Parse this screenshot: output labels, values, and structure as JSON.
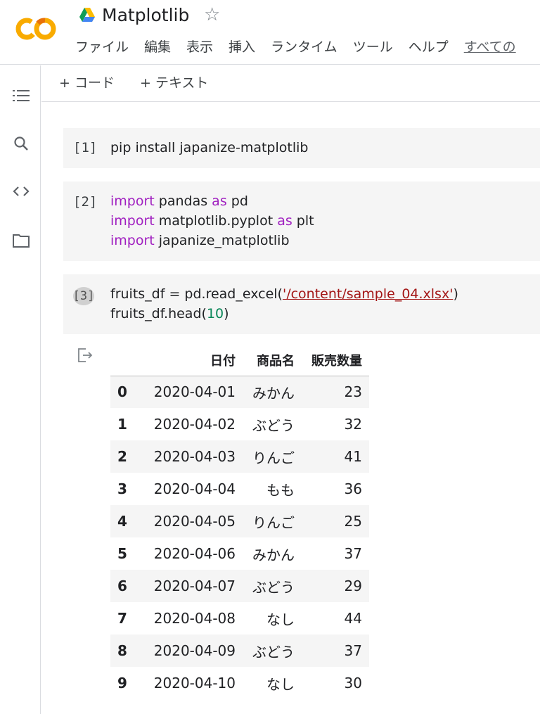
{
  "app": {
    "logo_text": "CO",
    "title": "Matplotlib",
    "star_icon": "☆"
  },
  "menu": [
    "ファイル",
    "編集",
    "表示",
    "挿入",
    "ランタイム",
    "ツール",
    "ヘルプ",
    "すべての"
  ],
  "toolbar": {
    "add_code": "+ コード",
    "add_text": "+ テキスト"
  },
  "rail_icons": [
    "toc-icon",
    "search-icon",
    "code-snippets-icon",
    "folder-icon"
  ],
  "cells": [
    {
      "exec": "[1]",
      "lines": [
        "pip install japanize-matplotlib"
      ]
    },
    {
      "exec": "[2]",
      "lines": [
        "import pandas as pd",
        "import matplotlib.pyplot as plt",
        "import japanize_matplotlib"
      ]
    },
    {
      "exec": "[3]",
      "lines": [
        "fruits_df = pd.read_excel('/content/sample_04.xlsx')",
        "fruits_df.head(10)"
      ]
    }
  ],
  "output_table": {
    "columns": [
      "日付",
      "商品名",
      "販売数量"
    ],
    "rows": [
      [
        "0",
        "2020-04-01",
        "みかん",
        "23"
      ],
      [
        "1",
        "2020-04-02",
        "ぶどう",
        "32"
      ],
      [
        "2",
        "2020-04-03",
        "りんご",
        "41"
      ],
      [
        "3",
        "2020-04-04",
        "もも",
        "36"
      ],
      [
        "4",
        "2020-04-05",
        "りんご",
        "25"
      ],
      [
        "5",
        "2020-04-06",
        "みかん",
        "37"
      ],
      [
        "6",
        "2020-04-07",
        "ぶどう",
        "29"
      ],
      [
        "7",
        "2020-04-08",
        "なし",
        "44"
      ],
      [
        "8",
        "2020-04-09",
        "ぶどう",
        "37"
      ],
      [
        "9",
        "2020-04-10",
        "なし",
        "30"
      ]
    ]
  },
  "colors": {
    "logo_orange": "#f9ab00",
    "logo_dark_orange": "#e8710a",
    "keyword": "#a020c0",
    "string": "#a31515",
    "number": "#098658"
  }
}
